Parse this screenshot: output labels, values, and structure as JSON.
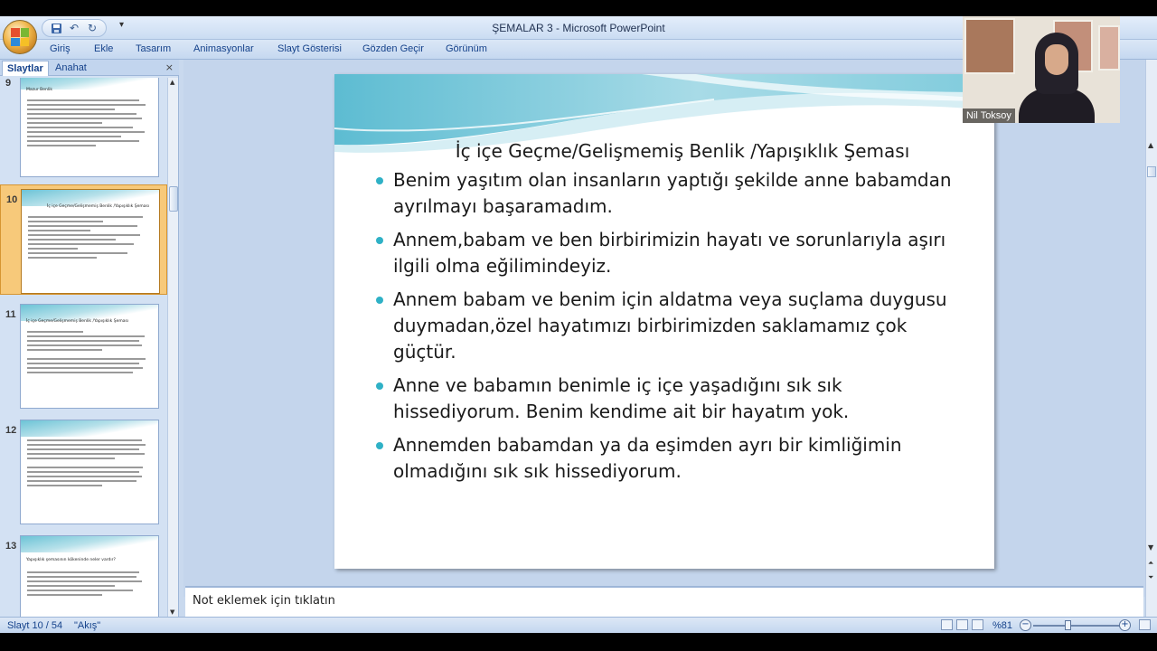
{
  "window": {
    "title": "ŞEMALAR 3 - Microsoft PowerPoint"
  },
  "quick_access": {
    "icons": [
      "save-icon",
      "undo-icon",
      "redo-icon",
      "customize-icon"
    ]
  },
  "ribbon": {
    "tabs": [
      "Giriş",
      "Ekle",
      "Tasarım",
      "Animasyonlar",
      "Slayt Gösterisi",
      "Gözden Geçir",
      "Görünüm"
    ]
  },
  "pane": {
    "tabs": [
      "Slaytlar",
      "Anahat"
    ],
    "close_label": "×",
    "slides": [
      {
        "num": "9",
        "title": "Mazur Benlik",
        "selected": false
      },
      {
        "num": "10",
        "title": "İç içe Geçme/Gelişmemiş Benlik /Yapışıklık Şeması",
        "selected": true
      },
      {
        "num": "11",
        "title": "İç içe Geçme/Gelişmemiş Benlik /Yapışıklık Şeması",
        "selected": false
      },
      {
        "num": "12",
        "title": "",
        "selected": false
      },
      {
        "num": "13",
        "title": "Yapışıklık şemasının kökeninde neler vardır?",
        "selected": false
      }
    ]
  },
  "slide": {
    "title": "İç içe Geçme/Gelişmemiş Benlik /Yapışıklık Şeması",
    "bullets": [
      "Benim yaşıtım olan insanların yaptığı şekilde anne babamdan ayrılmayı başaramadım.",
      "Annem,babam ve ben birbirimizin hayatı ve sorunlarıyla aşırı ilgili olma  eğilimindeyiz.",
      "Annem babam ve benim için aldatma veya suçlama duygusu duymadan,özel hayatımızı birbirimizden saklamamız çok güçtür.",
      "Anne ve babamın benimle iç içe yaşadığını sık sık hissediyorum. Benim kendime ait bir hayatım yok.",
      "Annemden babamdan ya da eşimden ayrı bir kimliğimin olmadığını sık sık hissediyorum."
    ],
    "accent_color": "#2fb1c6"
  },
  "notes": {
    "placeholder": "Not eklemek için tıklatın"
  },
  "status": {
    "slide_counter": "Slayt 10 / 54",
    "theme": "\"Akış\"",
    "zoom": "%81",
    "zoom_percent": 81
  },
  "webcam": {
    "name": "Nil Toksoy"
  }
}
